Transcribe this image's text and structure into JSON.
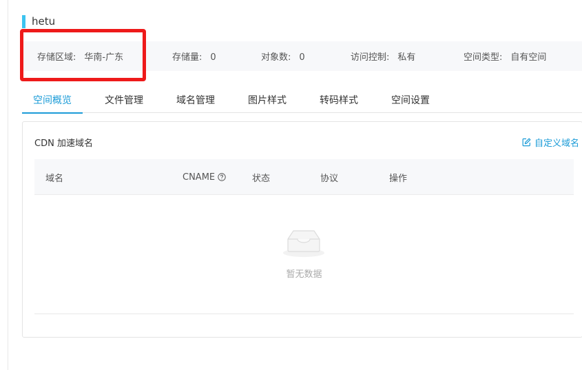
{
  "bucket": {
    "name": "hetu"
  },
  "info": {
    "region_label": "存储区域:",
    "region_value": "华南-广东",
    "storage_label": "存储量:",
    "storage_value": "0",
    "objects_label": "对象数:",
    "objects_value": "0",
    "access_label": "访问控制:",
    "access_value": "私有",
    "space_type_label": "空间类型:",
    "space_type_value": "自有空间"
  },
  "tabs": [
    {
      "label": "空间概览",
      "active": true
    },
    {
      "label": "文件管理",
      "active": false
    },
    {
      "label": "域名管理",
      "active": false
    },
    {
      "label": "图片样式",
      "active": false
    },
    {
      "label": "转码样式",
      "active": false
    },
    {
      "label": "空间设置",
      "active": false
    }
  ],
  "cdn": {
    "title": "CDN 加速域名",
    "custom_domain_label": "自定义域名",
    "columns": {
      "domain": "域名",
      "cname": "CNAME",
      "status": "状态",
      "protocol": "协议",
      "actions": "操作"
    },
    "empty_text": "暂无数据"
  },
  "colors": {
    "accent": "#1a9bd7",
    "title_accent": "#3cc4f0",
    "highlight": "#ee1a1a"
  },
  "icons": {
    "edit": "edit-icon",
    "help": "help-circle-icon",
    "empty": "empty-inbox-icon"
  }
}
